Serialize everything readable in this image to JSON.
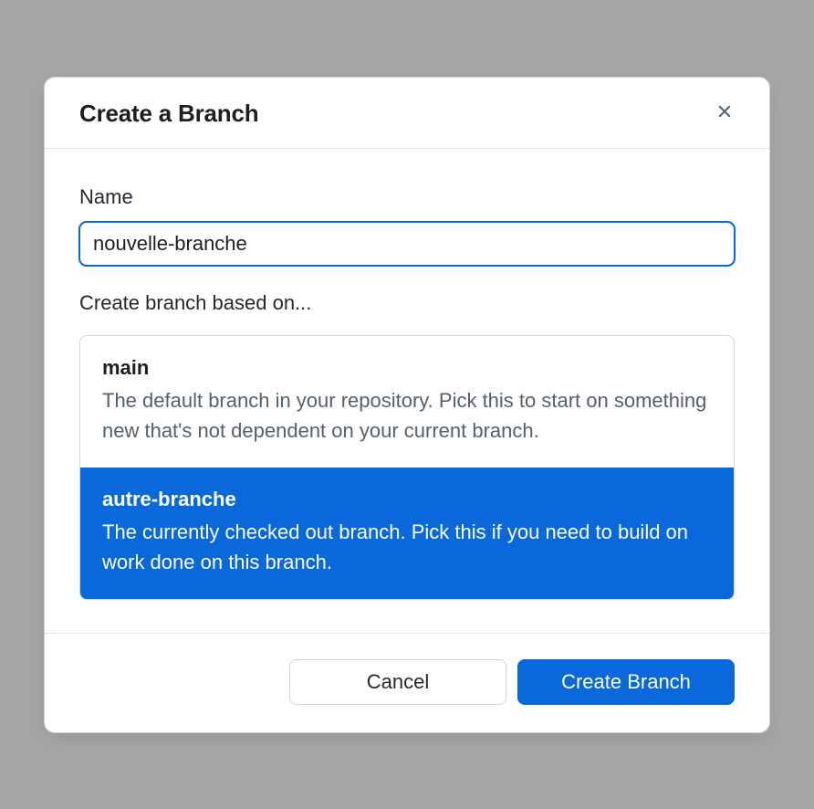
{
  "dialog": {
    "title": "Create a Branch",
    "name_label": "Name",
    "name_value": "nouvelle-branche",
    "base_label": "Create branch based on...",
    "options": [
      {
        "title": "main",
        "description": "The default branch in your repository. Pick this to start on something new that's not dependent on your current branch.",
        "selected": false
      },
      {
        "title": "autre-branche",
        "description": "The currently checked out branch. Pick this if you need to build on work done on this branch.",
        "selected": true
      }
    ],
    "cancel_label": "Cancel",
    "submit_label": "Create Branch"
  }
}
